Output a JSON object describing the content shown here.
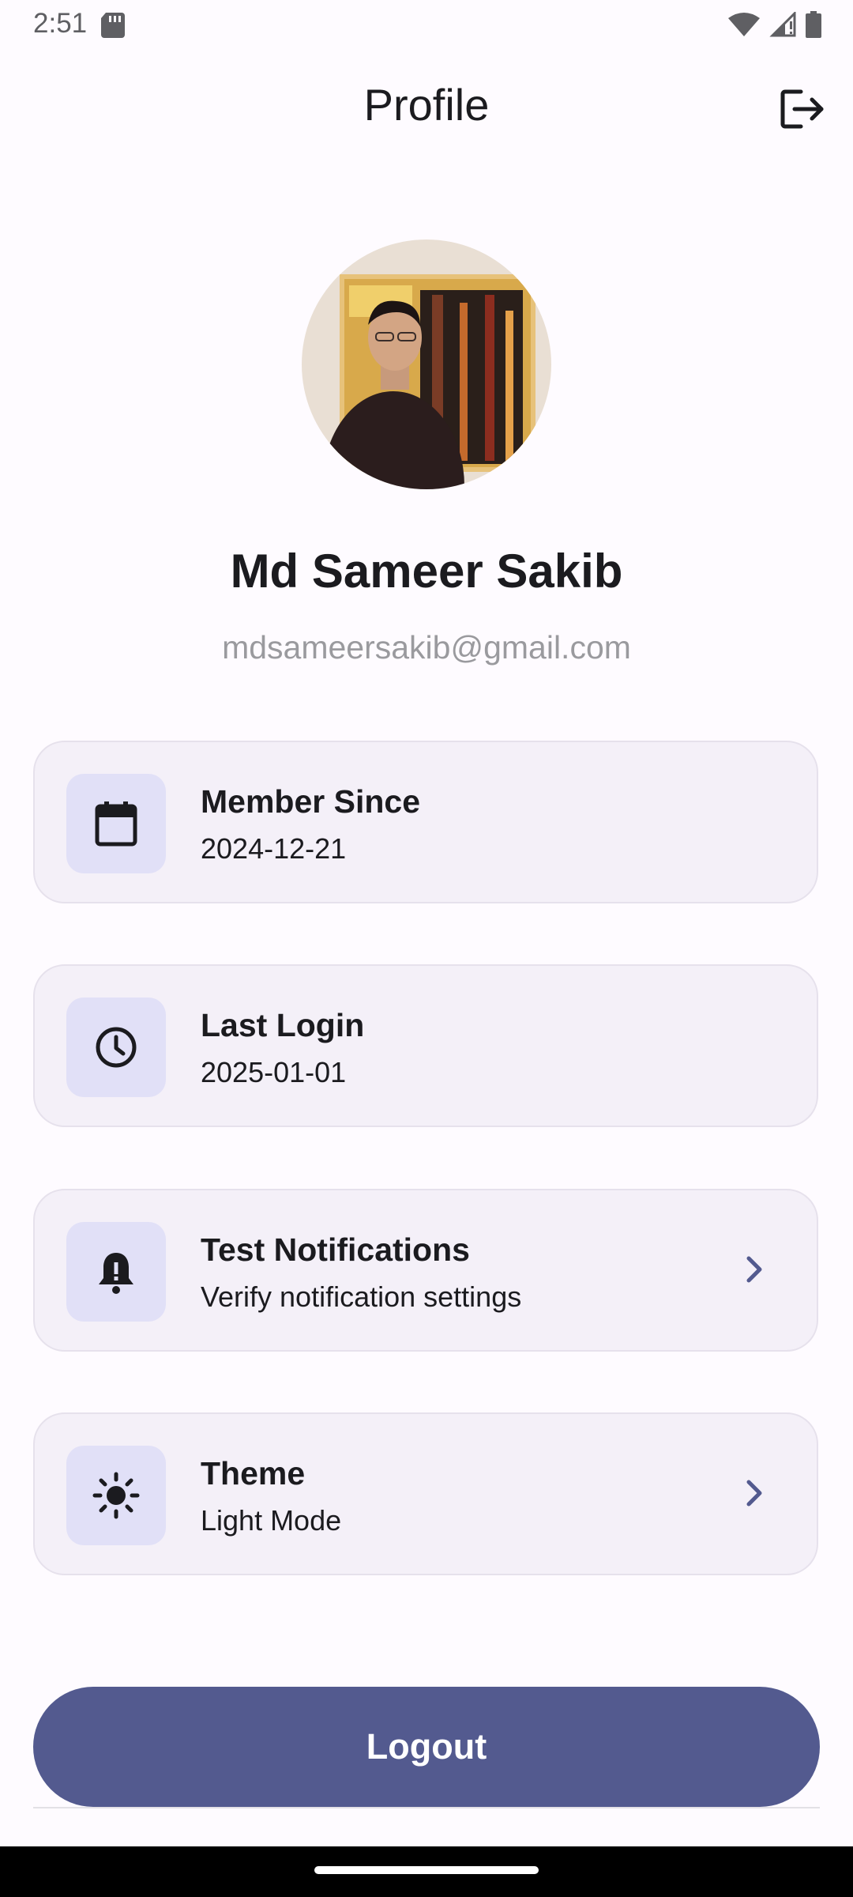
{
  "status_bar": {
    "time": "2:51"
  },
  "app_bar": {
    "title": "Profile"
  },
  "profile": {
    "name": "Md Sameer Sakib",
    "email": "mdsameersakib@gmail.com"
  },
  "cards": [
    {
      "title": "Member Since",
      "subtitle": "2024-12-21",
      "icon": "calendar-icon"
    },
    {
      "title": "Last Login",
      "subtitle": "2025-01-01",
      "icon": "clock-icon"
    },
    {
      "title": "Test Notifications",
      "subtitle": "Verify notification settings",
      "icon": "bell-icon"
    },
    {
      "title": "Theme",
      "subtitle": "Light Mode",
      "icon": "sun-icon"
    }
  ],
  "logout_button": {
    "label": "Logout"
  },
  "colors": {
    "primary": "#535a8f",
    "card_bg": "#f4f0f8",
    "icon_box_bg": "#e1e0f7"
  }
}
